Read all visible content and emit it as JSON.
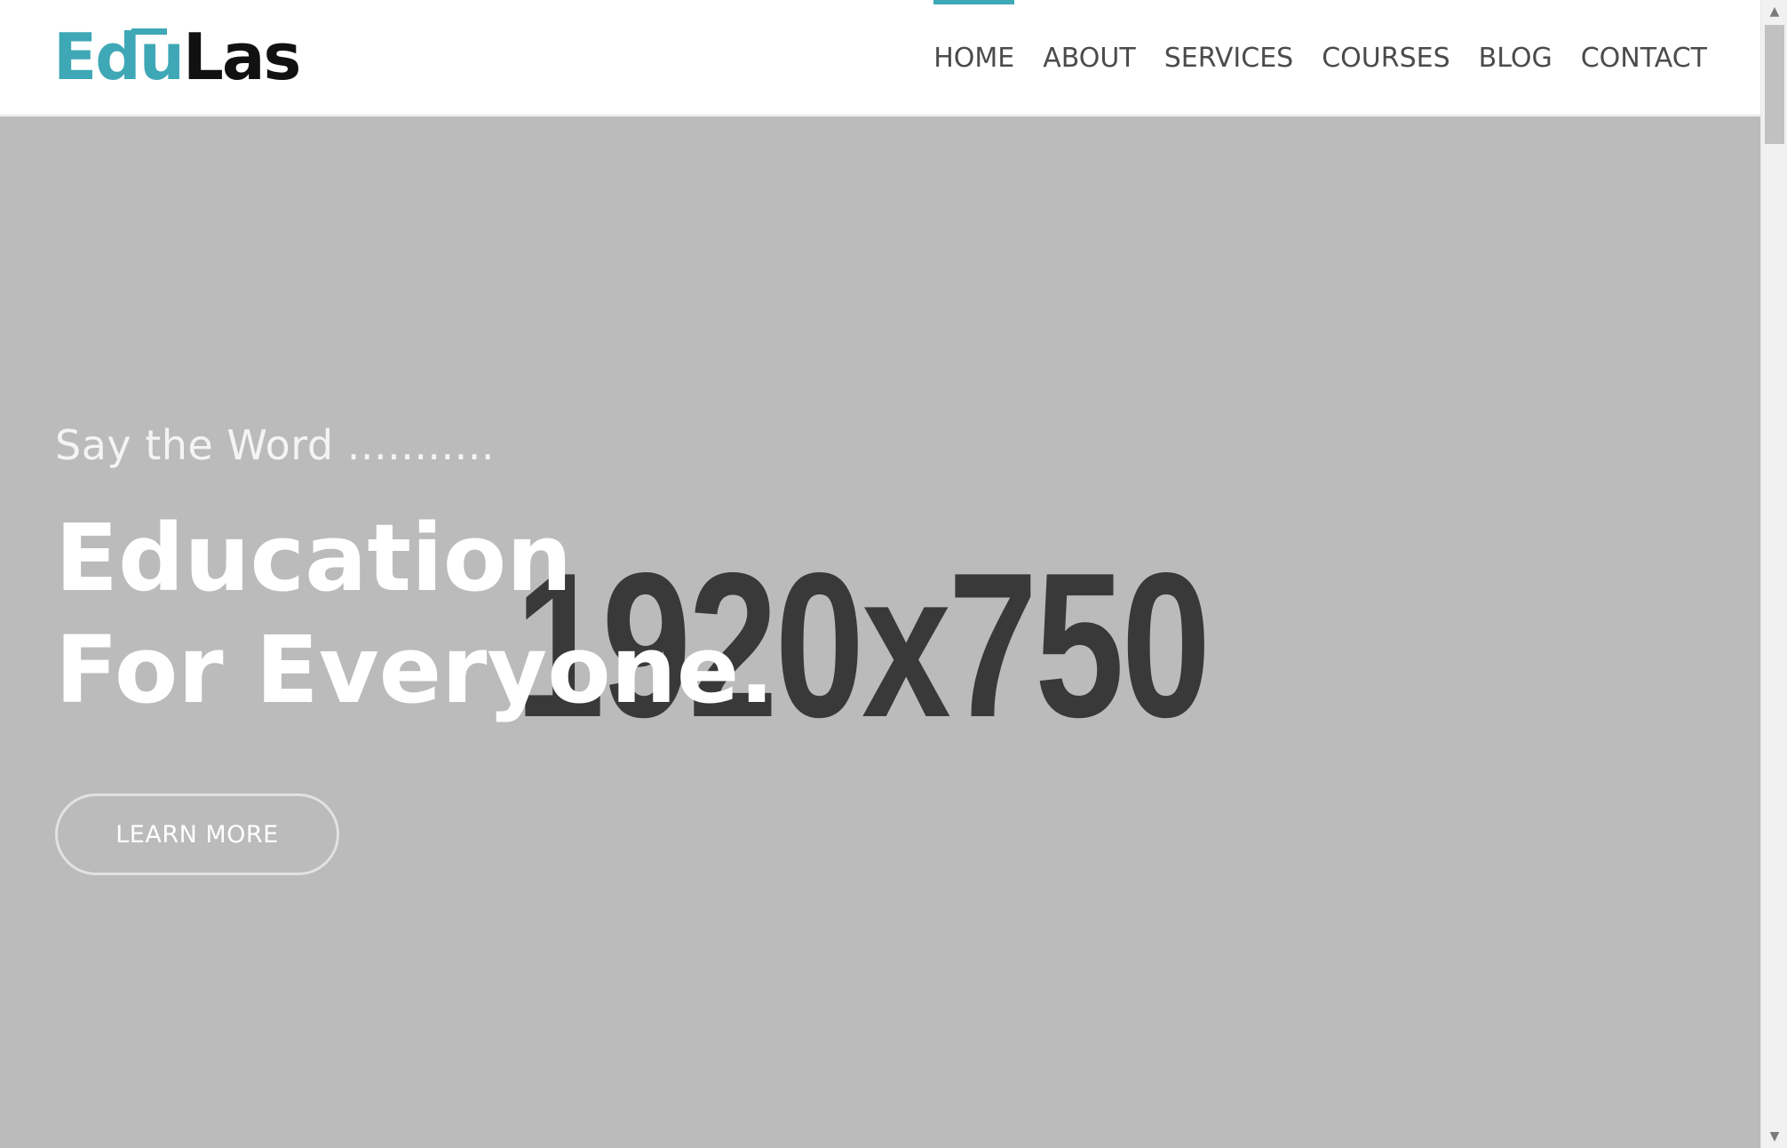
{
  "brand": {
    "name_part_1": "Edu",
    "name_part_2": "Las",
    "accent_color": "#3ea8b6"
  },
  "nav": {
    "items": [
      {
        "label": "HOME",
        "active": true
      },
      {
        "label": "ABOUT",
        "active": false
      },
      {
        "label": "SERVICES",
        "active": false
      },
      {
        "label": "COURSES",
        "active": false
      },
      {
        "label": "BLOG",
        "active": false
      },
      {
        "label": "CONTACT",
        "active": false
      }
    ]
  },
  "hero": {
    "placeholder_label": "1920x750",
    "eyebrow": "Say the Word ...........",
    "title_line_1": "Education",
    "title_line_2": "For Everyone.",
    "cta_label": "LEARN MORE",
    "background_color": "#bbbbbb"
  },
  "scrollbar": {
    "up_icon": "triangle-up-icon",
    "down_icon": "triangle-down-icon"
  }
}
